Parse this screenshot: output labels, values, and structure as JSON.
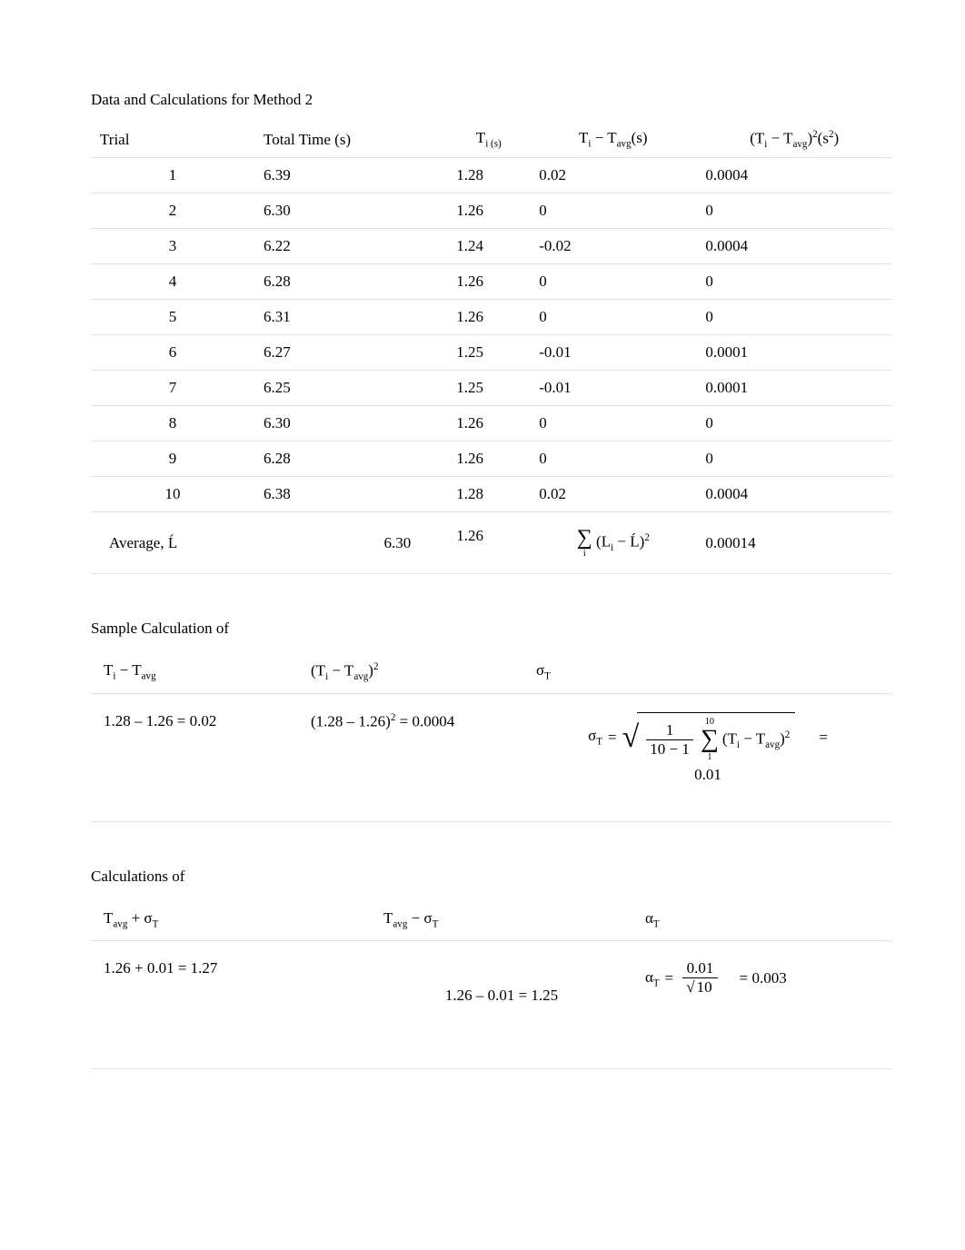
{
  "titles": {
    "title1": "Data and Calculations for Method 2",
    "title2": "Sample Calculation of",
    "title3": "Calculations of"
  },
  "main_table": {
    "headers": {
      "c1": "Trial",
      "c2": "Total Time (s)",
      "c3_base": "T",
      "c3_sub": "i (s)",
      "c4_pre": "T",
      "c4_sub1": "i",
      "c4_mid": " − T",
      "c4_sub2": "avg",
      "c4_post": "(s)",
      "c5_open": "(",
      "c5_pre": "T",
      "c5_sub1": "i",
      "c5_mid": " − T",
      "c5_sub2": "avg",
      "c5_close": ")",
      "c5_exp": "2",
      "c5_unit": "(s",
      "c5_unit_exp": "2",
      "c5_unit_close": ")"
    },
    "rows": [
      {
        "trial": "1",
        "total": "6.39",
        "ti": "1.28",
        "diff": "0.02",
        "sq": "0.0004"
      },
      {
        "trial": "2",
        "total": "6.30",
        "ti": "1.26",
        "diff": "0",
        "sq": "0"
      },
      {
        "trial": "3",
        "total": "6.22",
        "ti": "1.24",
        "diff": "-0.02",
        "sq": "0.0004"
      },
      {
        "trial": "4",
        "total": "6.28",
        "ti": "1.26",
        "diff": "0",
        "sq": "0"
      },
      {
        "trial": "5",
        "total": "6.31",
        "ti": "1.26",
        "diff": "0",
        "sq": "0"
      },
      {
        "trial": "6",
        "total": "6.27",
        "ti": "1.25",
        "diff": "-0.01",
        "sq": "0.0001"
      },
      {
        "trial": "7",
        "total": "6.25",
        "ti": "1.25",
        "diff": "-0.01",
        "sq": "0.0001"
      },
      {
        "trial": "8",
        "total": "6.30",
        "ti": "1.26",
        "diff": "0",
        "sq": "0"
      },
      {
        "trial": "9",
        "total": "6.28",
        "ti": "1.26",
        "diff": "0",
        "sq": "0"
      },
      {
        "trial": "10",
        "total": "6.38",
        "ti": "1.28",
        "diff": "0.02",
        "sq": "0.0004"
      }
    ],
    "avg": {
      "label": "Average,   Ĺ",
      "total": "6.30",
      "ti": "1.26",
      "sum_pre": "(L",
      "sum_sub": "i",
      "sum_mid": " − Ĺ)",
      "sum_exp": "2",
      "sq": "0.00014"
    }
  },
  "sample_table": {
    "headers": {
      "c1_pre": "T",
      "c1_sub1": "i",
      "c1_mid": " − T",
      "c1_sub2": "avg",
      "c2_open": "(",
      "c2_pre": "T",
      "c2_sub1": "i",
      "c2_mid": " − T",
      "c2_sub2": "avg",
      "c2_close": ")",
      "c2_exp": "2",
      "c3": "σ",
      "c3_sub": "T"
    },
    "row": {
      "c1": "1.28 – 1.26 = 0.02",
      "c2": "(1.28 – 1.26)",
      "c2_exp": "2",
      "c2_post": " = 0.0004",
      "sigma_lhs": "σ",
      "sigma_lhs_sub": "T",
      "eq1": "=",
      "frac_num": "1",
      "frac_den": "10 − 1",
      "lim_top": "10",
      "lim_bot": "1",
      "term_open": "(",
      "term_t": "T",
      "term_sub1": "i",
      "term_mid": " − T",
      "term_sub2": "avg",
      "term_close": ")",
      "term_exp": "2",
      "eq2": "=",
      "result": "0.01"
    }
  },
  "calc_table": {
    "headers": {
      "c1_pre": "T",
      "c1_sub": "avg",
      "c1_mid": " + σ",
      "c1_sub2": "T",
      "c2_pre": "T",
      "c2_sub": "avg",
      "c2_mid": " − σ",
      "c2_sub2": "T",
      "c3": "α",
      "c3_sub": "T"
    },
    "row": {
      "c1": "1.26 + 0.01 = 1.27",
      "c2": "1.26 – 0.01 = 1.25",
      "alpha_lhs": "α",
      "alpha_lhs_sub": "T",
      "eq": "=",
      "frac_num": "0.01",
      "frac_den_pre": "√",
      "frac_den": "10",
      "eq2": " = 0.003"
    }
  }
}
